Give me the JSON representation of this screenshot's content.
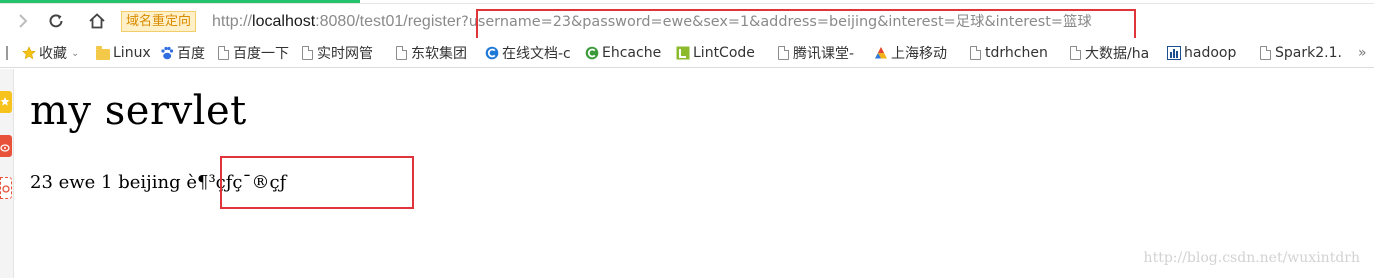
{
  "toolbar": {
    "redirect_badge": "域名重定向",
    "url": {
      "scheme": "http://",
      "host": "localhost",
      "rest": ":8080/test01/register",
      "query": "?username=23&password=ewe&sex=1&address=beijing&interest=足球&interest=篮球"
    }
  },
  "bookmarks": [
    {
      "label": "收藏",
      "icon": "star-icon"
    },
    {
      "label": "Linux",
      "icon": "folder-icon"
    },
    {
      "label": "百度",
      "icon": "baidu-icon"
    },
    {
      "label": "百度一下",
      "icon": "page-icon"
    },
    {
      "label": "实时网管",
      "icon": "page-icon"
    },
    {
      "label": "东软集团",
      "icon": "page-icon"
    },
    {
      "label": "在线文档-c",
      "icon": "blue-globe-icon"
    },
    {
      "label": "Ehcache",
      "icon": "green-c-icon"
    },
    {
      "label": "LintCode",
      "icon": "lintcode-icon"
    },
    {
      "label": "腾讯课堂-",
      "icon": "page-icon"
    },
    {
      "label": "上海移动",
      "icon": "triangle-logo-icon"
    },
    {
      "label": "tdrhchen",
      "icon": "page-icon"
    },
    {
      "label": "大数据/ha",
      "icon": "page-icon"
    },
    {
      "label": "hadoop",
      "icon": "bar-chart-icon"
    },
    {
      "label": "Spark2.1.",
      "icon": "page-icon"
    },
    {
      "label": "»",
      "icon": ""
    }
  ],
  "content": {
    "heading": "my servlet",
    "result_plain": "23 ewe 1 beijing ",
    "result_garbled": "è¶³çƒç¯®çƒ"
  },
  "watermark": "http://blog.csdn.net/wuxintdrh",
  "colors": {
    "highlight_border": "#e0343b",
    "progress": "#27c26d",
    "badge_bg": "#fff0c7",
    "badge_text": "#d98b00"
  }
}
